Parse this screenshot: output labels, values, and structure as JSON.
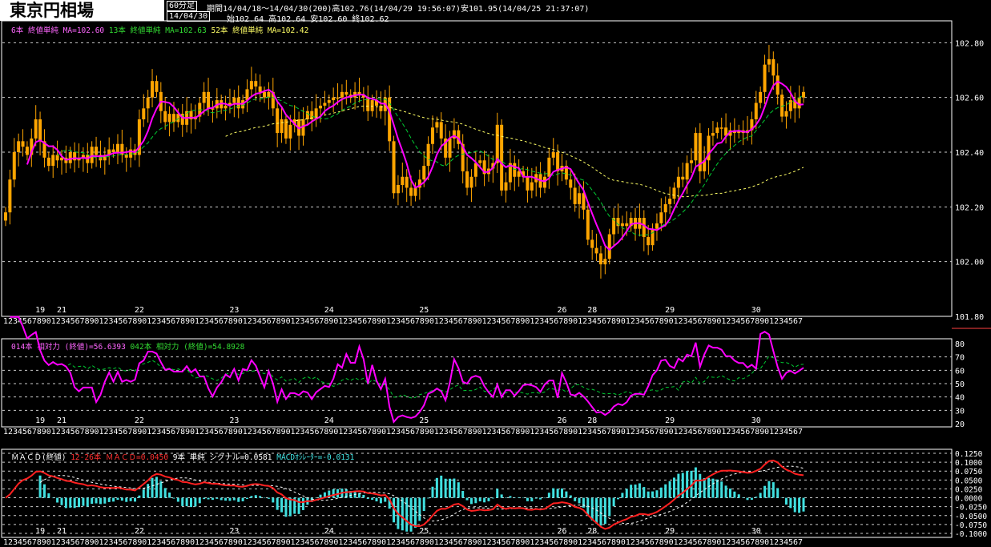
{
  "header": {
    "title": "東京円相場",
    "timeframe": "60分足",
    "period": "期間14/04/18～14/04/30(200)高102.76(14/04/29 19:56:07)安101.95(14/04/25 21:37:07)",
    "date": "14/04/30",
    "ohlc": "始102.64 高102.64 安102.60 終102.62"
  },
  "colors": {
    "candle": "#ffa500",
    "ma_short": "#ff00ff",
    "ma_mid": "#00cc33",
    "ma_long": "#ffff66",
    "macd": "#ff2020",
    "signal": "#ffffff",
    "histogram": "#40e0e0",
    "grid": "#cccccc",
    "panel_border": "#ffffff"
  },
  "legends": {
    "main": [
      {
        "text": "6本 終値単純 MA=102.60",
        "color": "#ff66ff"
      },
      {
        "text": "13本 終値単純 MA=102.63",
        "color": "#33dd33"
      },
      {
        "text": "52本 終値単純 MA=102.42",
        "color": "#ffff66"
      }
    ],
    "rsi": [
      {
        "text": "014本 相対力 (終値)=56.6393",
        "color": "#ff66ff"
      },
      {
        "text": "042本 相対力 (終値)=54.8928",
        "color": "#33dd33"
      }
    ],
    "macd": [
      {
        "text": "ＭＡＣＤ(終値)",
        "color": "#ffffff"
      },
      {
        "text": "12-26本 ＭＡＣＤ=0.0450",
        "color": "#ff3030"
      },
      {
        "text": "9本 単純 シグナル=0.0581",
        "color": "#ffffff"
      },
      {
        "text": "MACDｵｼﾚｰﾀｰ=-0.0131",
        "color": "#40e0e0"
      }
    ]
  },
  "chart_data": [
    {
      "type": "candlestick",
      "yticks": [
        "102.80",
        "102.60",
        "102.40",
        "102.20",
        "102.00",
        "101.80"
      ],
      "ylim": [
        101.8,
        102.88
      ],
      "grid": true,
      "day_labels": [
        "19",
        "21",
        "22",
        "23",
        "24",
        "25",
        "26",
        "28",
        "29",
        "30"
      ],
      "hour_tick_row": "12345678901234567890123456789012345678901234567890123456789012345678901234567890123456789012345678901234567890123456789012345678901234567890123456789012345678901234567",
      "closes": [
        102.18,
        102.3,
        102.4,
        102.44,
        102.42,
        102.39,
        102.45,
        102.52,
        102.44,
        102.38,
        102.35,
        102.39,
        102.37,
        102.38,
        102.36,
        102.4,
        102.37,
        102.38,
        102.39,
        102.36,
        102.42,
        102.39,
        102.37,
        102.39,
        102.41,
        102.4,
        102.43,
        102.39,
        102.38,
        102.41,
        102.39,
        102.52,
        102.56,
        102.6,
        102.66,
        102.62,
        102.55,
        102.51,
        102.54,
        102.51,
        102.54,
        102.5,
        102.55,
        102.52,
        102.53,
        102.58,
        102.62,
        102.56,
        102.56,
        102.59,
        102.56,
        102.57,
        102.58,
        102.6,
        102.56,
        102.59,
        102.63,
        102.66,
        102.64,
        102.62,
        102.6,
        102.62,
        102.56,
        102.47,
        102.52,
        102.45,
        102.5,
        102.52,
        102.46,
        102.52,
        102.55,
        102.52,
        102.56,
        102.57,
        102.58,
        102.59,
        102.6,
        102.6,
        102.62,
        102.61,
        102.6,
        102.62,
        102.61,
        102.6,
        102.55,
        102.59,
        102.57,
        102.55,
        102.6,
        102.44,
        102.25,
        102.28,
        102.31,
        102.27,
        102.24,
        102.27,
        102.3,
        102.35,
        102.43,
        102.49,
        102.51,
        102.45,
        102.38,
        102.45,
        102.48,
        102.43,
        102.33,
        102.27,
        102.31,
        102.36,
        102.37,
        102.32,
        102.34,
        102.36,
        102.5,
        102.26,
        102.29,
        102.36,
        102.31,
        102.33,
        102.31,
        102.26,
        102.29,
        102.32,
        102.27,
        102.31,
        102.38,
        102.4,
        102.33,
        102.35,
        102.3,
        102.27,
        102.21,
        102.25,
        102.19,
        102.08,
        102.05,
        102.03,
        101.99,
        102.01,
        102.1,
        102.16,
        102.13,
        102.14,
        102.13,
        102.16,
        102.12,
        102.16,
        102.09,
        102.06,
        102.12,
        102.14,
        102.18,
        102.21,
        102.23,
        102.27,
        102.31,
        102.3,
        102.36,
        102.37,
        102.47,
        102.33,
        102.37,
        102.46,
        102.47,
        102.49,
        102.49,
        102.46,
        102.48,
        102.47,
        102.48,
        102.47,
        102.48,
        102.52,
        102.58,
        102.62,
        102.72,
        102.74,
        102.68,
        102.61,
        102.53,
        102.55,
        102.59,
        102.56,
        102.6,
        102.62
      ]
    },
    {
      "type": "line",
      "name": "相対力",
      "yticks": [
        "80",
        "70",
        "60",
        "50",
        "40",
        "30",
        "20"
      ],
      "ylim": [
        20,
        80
      ]
    },
    {
      "type": "macd",
      "yticks": [
        "0.1250",
        "0.1000",
        "0.0750",
        "0.0500",
        "0.0250",
        "0.0000",
        "-0.0250",
        "-0.0500",
        "-0.0750",
        "-0.1000"
      ],
      "ylim": [
        -0.1,
        0.125
      ]
    }
  ]
}
